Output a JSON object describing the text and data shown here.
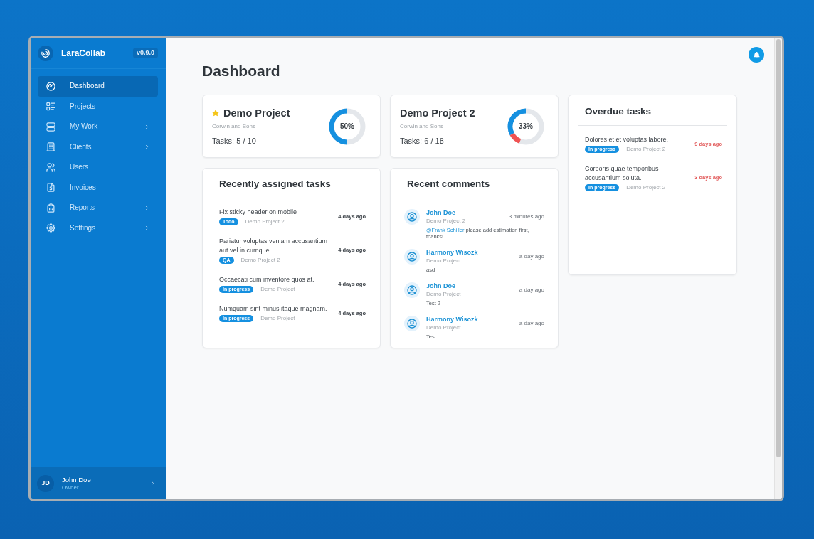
{
  "app": {
    "name": "LaraCollab",
    "version": "v0.9.0"
  },
  "sidebar": {
    "items": [
      {
        "label": "Dashboard",
        "selected": true,
        "expandable": false
      },
      {
        "label": "Projects",
        "selected": false,
        "expandable": false
      },
      {
        "label": "My Work",
        "selected": false,
        "expandable": true
      },
      {
        "label": "Clients",
        "selected": false,
        "expandable": true
      },
      {
        "label": "Users",
        "selected": false,
        "expandable": false
      },
      {
        "label": "Invoices",
        "selected": false,
        "expandable": false
      },
      {
        "label": "Reports",
        "selected": false,
        "expandable": true
      },
      {
        "label": "Settings",
        "selected": false,
        "expandable": true
      }
    ]
  },
  "user": {
    "initials": "JD",
    "name": "John Doe",
    "role": "Owner"
  },
  "page": {
    "title": "Dashboard"
  },
  "projects": [
    {
      "name": "Demo Project",
      "favorite": true,
      "client": "Corwin and Sons",
      "tasks": "Tasks: 5 / 10",
      "progress": {
        "reading": "50%",
        "segments": [
          {
            "kind": "done",
            "level": 0.5
          }
        ]
      }
    },
    {
      "name": "Demo Project 2",
      "favorite": false,
      "client": "Corwin and Sons",
      "tasks": "Tasks: 6 / 18",
      "progress": {
        "reading": "33%",
        "segments": [
          {
            "kind": "done",
            "level": 0.33
          },
          {
            "kind": "overdue",
            "level": 0.11
          }
        ]
      }
    }
  ],
  "recent_tasks": {
    "title": "Recently assigned tasks",
    "items": [
      {
        "title": "Fix sticky header on mobile",
        "status": "Todo",
        "project": "Demo Project 2",
        "time": "4 days ago"
      },
      {
        "title": "Pariatur voluptas veniam accusantium aut vel in cumque.",
        "status": "QA",
        "project": "Demo Project 2",
        "time": "4 days ago"
      },
      {
        "title": "Occaecati cum inventore quos at.",
        "status": "In progress",
        "project": "Demo Project",
        "time": "4 days ago"
      },
      {
        "title": "Numquam sint minus itaque magnam.",
        "status": "In progress",
        "project": "Demo Project",
        "time": "4 days ago"
      }
    ]
  },
  "recent_comments": {
    "title": "Recent comments",
    "items": [
      {
        "author": "John Doe",
        "project": "Demo Project 2",
        "time": "3 minutes ago",
        "mention": "@Frank Schiller",
        "text": "please add estimation first, thanks!"
      },
      {
        "author": "Harmony Wisozk",
        "project": "Demo Project",
        "time": "a day ago",
        "text": "asd"
      },
      {
        "author": "John Doe",
        "project": "Demo Project",
        "time": "a day ago",
        "text": "Test 2"
      },
      {
        "author": "Harmony Wisozk",
        "project": "Demo Project",
        "time": "a day ago",
        "text": "Test"
      }
    ]
  },
  "overdue_tasks": {
    "title": "Overdue tasks",
    "items": [
      {
        "title": "Dolores et et voluptas labore.",
        "status": "In progress",
        "project": "Demo Project 2",
        "time": "9 days ago"
      },
      {
        "title": "Corporis quae temporibus accusantium soluta.",
        "status": "In progress",
        "project": "Demo Project 2",
        "time": "3 days ago"
      }
    ]
  }
}
